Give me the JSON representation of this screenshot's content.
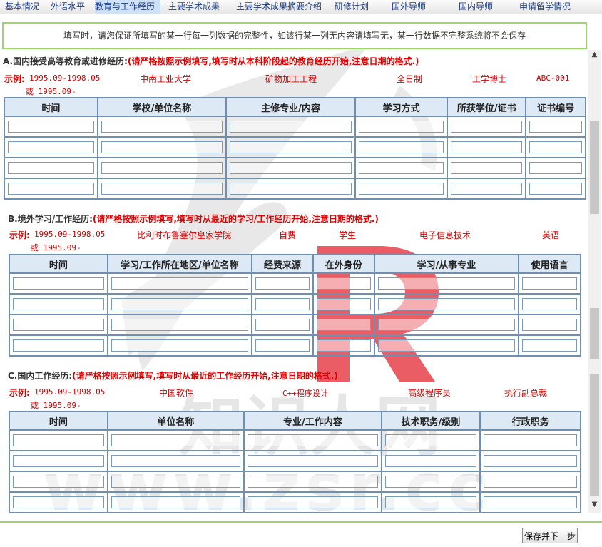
{
  "tabs": [
    "基本情况",
    "外语水平",
    "教育与工作经历",
    "主要学术成果",
    "主要学术成果摘要介绍",
    "研修计划",
    "国外导师",
    "国内导师",
    "申请留学情况"
  ],
  "active_tab": 2,
  "notice": "填写时，请您保证所填写的某一行每一列数据的完整性，如该行某一列无内容请填写无，某一行数据不完整系统将不会保存",
  "sectionA": {
    "title": "A.国内接受高等教育或进修经历:",
    "warning": "(请严格按照示例填写,填写时从本科阶段起的教育经历开始,注意日期的格式.)",
    "example_label": "示例:",
    "example_date": "1995.09-1998.05",
    "example_date2": "或 1995.09-",
    "example": [
      "中南工业大学",
      "矿物加工工程",
      "全日制",
      "工学博士",
      "ABC-001"
    ],
    "headers": [
      "时间",
      "学校/单位名称",
      "主修专业/内容",
      "学习方式",
      "所获学位/证书",
      "证书编号"
    ],
    "rows": 4
  },
  "sectionB": {
    "title": "B.境外学习/工作经历:",
    "warning": "(请严格按照示例填写,填写时从最近的学习/工作经历开始,注意日期的格式.)",
    "example_label": "示例:",
    "example_date": "1995.09-1998.05",
    "example_date2": "或 1995.09-",
    "example": [
      "比利时布鲁塞尔皇家学院",
      "自费",
      "学生",
      "电子信息技术",
      "英语"
    ],
    "headers": [
      "时间",
      "学习/工作所在地区/单位名称",
      "经费来源",
      "在外身份",
      "学习/从事专业",
      "使用语言"
    ],
    "rows": 4
  },
  "sectionC": {
    "title": "C.国内工作经历:",
    "warning": "(请严格按照示例填写,填写时从最近的工作经历开始,注意日期的格式.)",
    "example_label": "示例:",
    "example_date": "1995.09-1998.05",
    "example_date2": "或 1995.09-",
    "example": [
      "中国软件",
      "C++程序设计",
      "高级程序员",
      "执行副总裁"
    ],
    "headers": [
      "时间",
      "单位名称",
      "专业/工作内容",
      "技术职务/级别",
      "行政职务"
    ],
    "rows": 4
  },
  "save_button": "保存并下一步",
  "watermark": {
    "site_text": "知识人网",
    "url_text": "www.zsr.cc",
    "logo_letter": "R"
  },
  "icons": {
    "scroll_up": "up-arrow-icon",
    "scroll_down": "down-arrow-icon"
  }
}
